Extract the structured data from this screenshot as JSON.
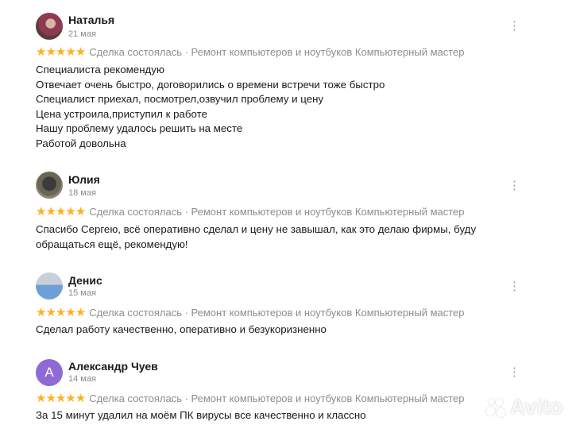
{
  "reviews": [
    {
      "name": "Наталья",
      "date": "21 мая",
      "stars": "★★★★★",
      "rating": 5,
      "meta": "Сделка состоялась · Ремонт компьютеров и ноутбуков Компьютерный мастер",
      "lines": [
        "Специалиста рекомендую",
        "Отвечает очень быстро, договорились о времени встречи тоже быстро",
        "Специалист приехал, посмотрел,озвучил проблему и цену",
        "Цена устроила,приступил к работе",
        "Нашу проблему удалось решить на месте",
        "Работой довольна"
      ]
    },
    {
      "name": "Юлия",
      "date": "18 мая",
      "stars": "★★★★★",
      "rating": 5,
      "meta": "Сделка состоялась · Ремонт компьютеров и ноутбуков Компьютерный мастер",
      "lines": [
        "Спасибо Сергею, всё оперативно сделал и цену не завышал, как это делаю фирмы, буду",
        "обращаться ещё, рекомендую!"
      ]
    },
    {
      "name": "Денис",
      "date": "15 мая",
      "stars": "★★★★★",
      "rating": 5,
      "meta": "Сделка состоялась · Ремонт компьютеров и ноутбуков Компьютерный мастер",
      "lines": [
        "Сделал работу качественно, оперативно и безукоризненно"
      ]
    },
    {
      "name": "Александр Чуев",
      "date": "14 мая",
      "avatar_letter": "А",
      "stars": "★★★★★",
      "rating": 5,
      "meta": "Сделка состоялась · Ремонт компьютеров и ноутбуков Компьютерный мастер",
      "lines": [
        "За 15 минут удалил на моём ПК вирусы все качественно и классно"
      ]
    }
  ],
  "menu_glyph": "⋮",
  "watermark": "Avito",
  "colors": {
    "star": "#ffb021",
    "meta": "#8d8d8d",
    "avatar_letter_bg": "#8f6ad4"
  }
}
